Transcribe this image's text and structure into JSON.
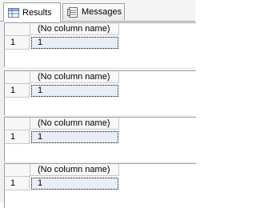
{
  "tabs": [
    {
      "label": "Results",
      "icon": "grid-icon",
      "active": true
    },
    {
      "label": "Messages",
      "icon": "messages-icon",
      "active": false
    }
  ],
  "result_sets": [
    {
      "column_header": "(No column name)",
      "rows": [
        {
          "row_number": "1",
          "value": "1"
        }
      ]
    },
    {
      "column_header": "(No column name)",
      "rows": [
        {
          "row_number": "1",
          "value": "1"
        }
      ]
    },
    {
      "column_header": "(No column name)",
      "rows": [
        {
          "row_number": "1",
          "value": "1"
        }
      ]
    },
    {
      "column_header": "(No column name)",
      "rows": [
        {
          "row_number": "1",
          "value": "1"
        }
      ]
    }
  ],
  "colors": {
    "selected_cell": "#e8eef7",
    "border": "#a0a0a0"
  }
}
